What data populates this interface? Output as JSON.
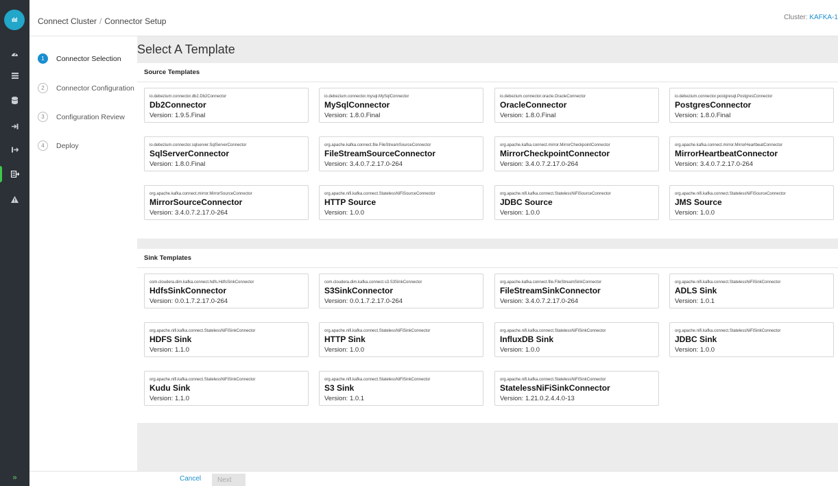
{
  "app": {
    "logo_text": "ılıl"
  },
  "header": {
    "breadcrumb": [
      "Connect Cluster",
      "Connector Setup"
    ],
    "cluster_label": "Cluster:",
    "cluster_name": "KAFKA-1"
  },
  "nav": {
    "icons": [
      "dashboard-icon",
      "list-icon",
      "database-icon",
      "input-icon",
      "output-icon",
      "connect-icon",
      "alert-icon"
    ],
    "active": "connect-icon",
    "expand": "»"
  },
  "steps": [
    {
      "num": "1",
      "label": "Connector Selection",
      "active": true
    },
    {
      "num": "2",
      "label": "Connector Configuration",
      "active": false
    },
    {
      "num": "3",
      "label": "Configuration Review",
      "active": false
    },
    {
      "num": "4",
      "label": "Deploy",
      "active": false
    }
  ],
  "main": {
    "title": "Select A Template"
  },
  "source": {
    "title": "Source Templates",
    "cards": [
      {
        "cls": "io.debezium.connector.db2.Db2Connector",
        "name": "Db2Connector",
        "version": "Version: 1.9.5.Final"
      },
      {
        "cls": "io.debezium.connector.mysql.MySqlConnector",
        "name": "MySqlConnector",
        "version": "Version: 1.8.0.Final"
      },
      {
        "cls": "io.debezium.connector.oracle.OracleConnector",
        "name": "OracleConnector",
        "version": "Version: 1.8.0.Final"
      },
      {
        "cls": "io.debezium.connector.postgresql.PostgresConnector",
        "name": "PostgresConnector",
        "version": "Version: 1.8.0.Final"
      },
      {
        "cls": "io.debezium.connector.sqlserver.SqlServerConnector",
        "name": "SqlServerConnector",
        "version": "Version: 1.8.0.Final"
      },
      {
        "cls": "org.apache.kafka.connect.file.FileStreamSourceConnector",
        "name": "FileStreamSourceConnector",
        "version": "Version: 3.4.0.7.2.17.0-264"
      },
      {
        "cls": "org.apache.kafka.connect.mirror.MirrorCheckpointConnector",
        "name": "MirrorCheckpointConnector",
        "version": "Version: 3.4.0.7.2.17.0-264"
      },
      {
        "cls": "org.apache.kafka.connect.mirror.MirrorHeartbeatConnector",
        "name": "MirrorHeartbeatConnector",
        "version": "Version: 3.4.0.7.2.17.0-264"
      },
      {
        "cls": "org.apache.kafka.connect.mirror.MirrorSourceConnector",
        "name": "MirrorSourceConnector",
        "version": "Version: 3.4.0.7.2.17.0-264"
      },
      {
        "cls": "org.apache.nifi.kafka.connect.StatelessNiFiSourceConnector",
        "name": "HTTP Source",
        "version": "Version: 1.0.0"
      },
      {
        "cls": "org.apache.nifi.kafka.connect.StatelessNiFiSourceConnector",
        "name": "JDBC Source",
        "version": "Version: 1.0.0"
      },
      {
        "cls": "org.apache.nifi.kafka.connect.StatelessNiFiSourceConnector",
        "name": "JMS Source",
        "version": "Version: 1.0.0"
      }
    ]
  },
  "sink": {
    "title": "Sink Templates",
    "cards": [
      {
        "cls": "com.cloudera.dim.kafka.connect.hdfs.HdfsSinkConnector",
        "name": "HdfsSinkConnector",
        "version": "Version: 0.0.1.7.2.17.0-264"
      },
      {
        "cls": "com.cloudera.dim.kafka.connect.s3.S3SinkConnector",
        "name": "S3SinkConnector",
        "version": "Version: 0.0.1.7.2.17.0-264"
      },
      {
        "cls": "org.apache.kafka.connect.file.FileStreamSinkConnector",
        "name": "FileStreamSinkConnector",
        "version": "Version: 3.4.0.7.2.17.0-264"
      },
      {
        "cls": "org.apache.nifi.kafka.connect.StatelessNiFiSinkConnector",
        "name": "ADLS Sink",
        "version": "Version: 1.0.1"
      },
      {
        "cls": "org.apache.nifi.kafka.connect.StatelessNiFiSinkConnector",
        "name": "HDFS Sink",
        "version": "Version: 1.1.0"
      },
      {
        "cls": "org.apache.nifi.kafka.connect.StatelessNiFiSinkConnector",
        "name": "HTTP Sink",
        "version": "Version: 1.0.0"
      },
      {
        "cls": "org.apache.nifi.kafka.connect.StatelessNiFiSinkConnector",
        "name": "InfluxDB Sink",
        "version": "Version: 1.0.0"
      },
      {
        "cls": "org.apache.nifi.kafka.connect.StatelessNiFiSinkConnector",
        "name": "JDBC Sink",
        "version": "Version: 1.0.0"
      },
      {
        "cls": "org.apache.nifi.kafka.connect.StatelessNiFiSinkConnector",
        "name": "Kudu Sink",
        "version": "Version: 1.1.0"
      },
      {
        "cls": "org.apache.nifi.kafka.connect.StatelessNiFiSinkConnector",
        "name": "S3 Sink",
        "version": "Version: 1.0.1"
      },
      {
        "cls": "org.apache.nifi.kafka.connect.StatelessNiFiSinkConnector",
        "name": "StatelessNiFiSinkConnector",
        "version": "Version: 1.21.0.2.4.4.0-13"
      }
    ]
  },
  "footer": {
    "cancel_label": "Cancel",
    "next_label": "Next"
  },
  "colors": {
    "accent": "#1a8ed0",
    "nav_bg": "#2b3137",
    "active_marker": "#3ec84a",
    "logo": "#22a6c9"
  }
}
